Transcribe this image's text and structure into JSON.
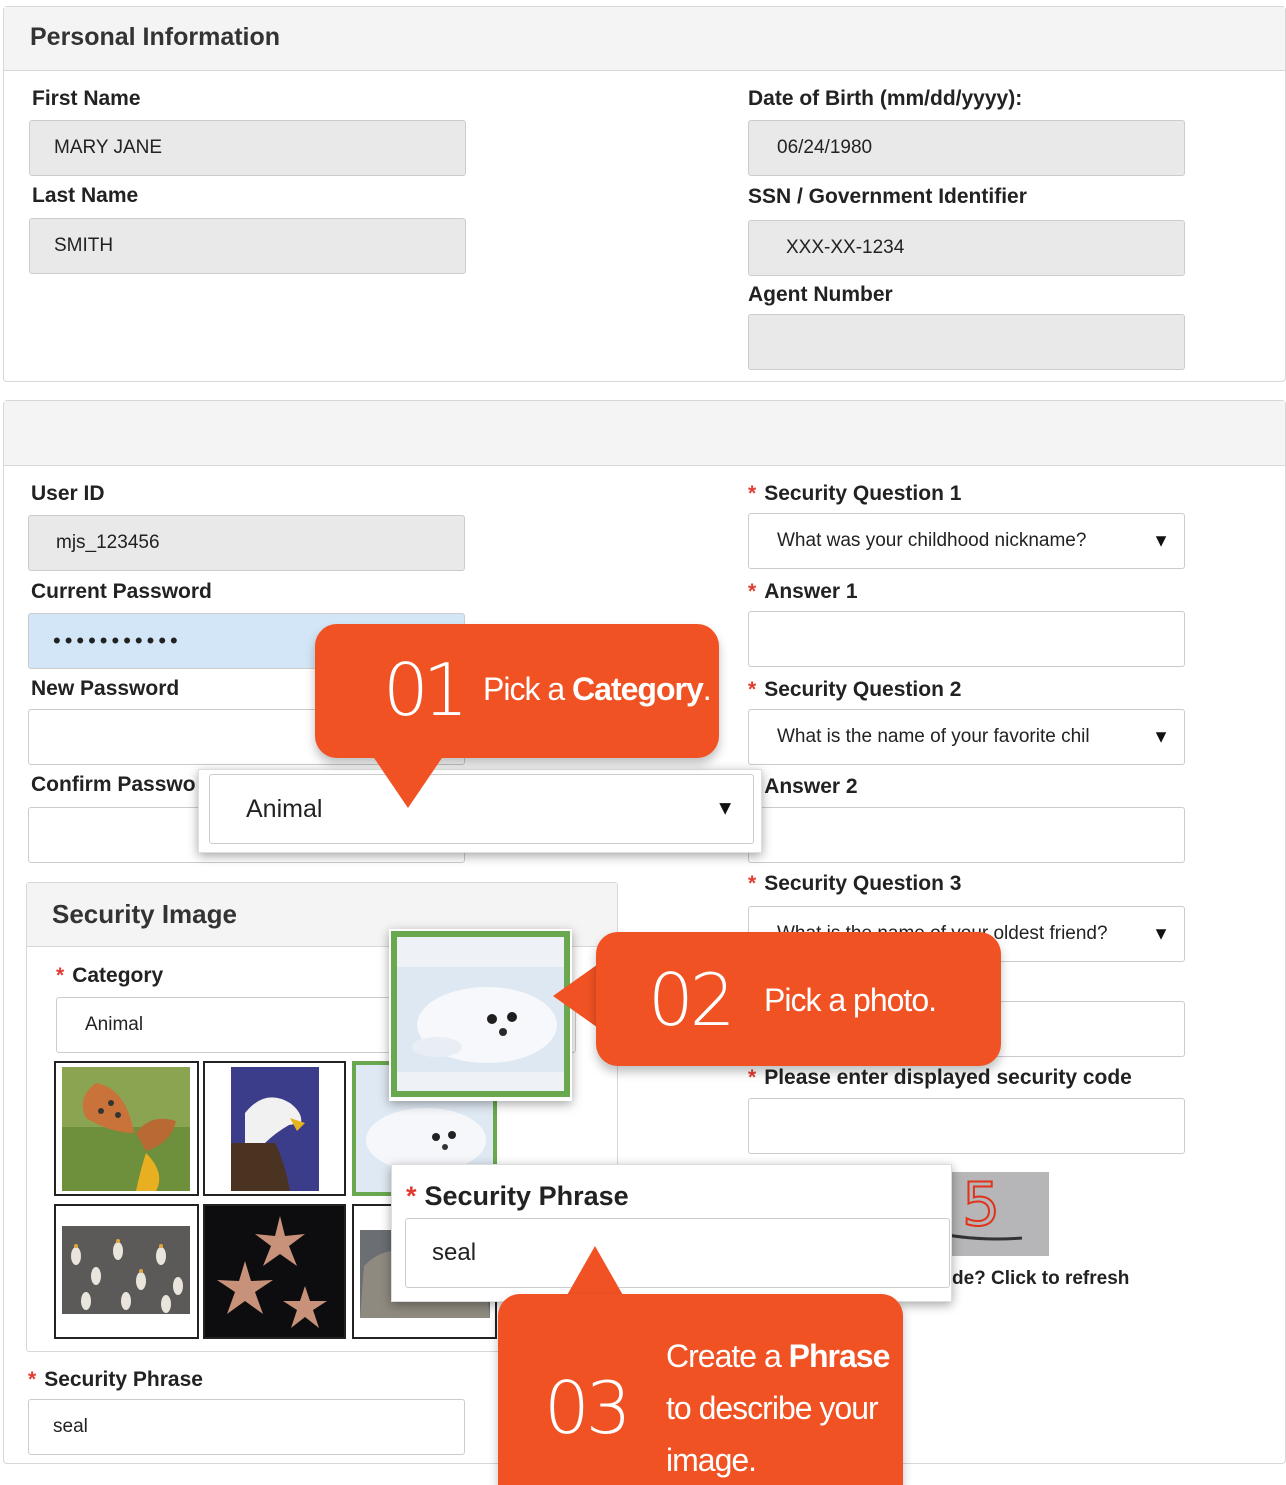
{
  "personal": {
    "title": "Personal Information",
    "first_name_label": "First Name",
    "first_name_value": "MARY JANE",
    "last_name_label": "Last Name",
    "last_name_value": "SMITH",
    "dob_label": "Date of Birth (mm/dd/yyyy):",
    "dob_value": "06/24/1980",
    "ssn_label": "SSN / Government Identifier",
    "ssn_value": "XXX-XX-1234",
    "agent_label": "Agent Number",
    "agent_value": ""
  },
  "account": {
    "user_id_label": "User ID",
    "user_id_value": "mjs_123456",
    "current_password_label": "Current Password",
    "current_password_value": "•••••••••••",
    "new_password_label": "New Password",
    "confirm_password_label": "Confirm Passwo",
    "sq1_label": "Security Question 1",
    "sq1_value": "What was your childhood nickname?",
    "answer1_label": "Answer 1",
    "sq2_label": "Security Question 2",
    "sq2_value": "What is the name of your favorite chil",
    "answer2_label": "Answer 2",
    "sq3_label": "Security Question 3",
    "sq3_value": "What is the name of your oldest friend?",
    "security_code_label": "Please enter displayed security code",
    "captcha_text": "5",
    "refresh_text": "de? Click to refresh",
    "required_mark": "*"
  },
  "security_image": {
    "title": "Security Image",
    "category_label": "Category",
    "category_value": "Animal",
    "phrase_label": "Security Phrase",
    "phrase_value": "seal",
    "images": [
      "butterfly",
      "eagle",
      "seal",
      "penguins",
      "starfish",
      "wolf"
    ]
  },
  "callouts": {
    "c1_num": "01",
    "c1_pre": "Pick a ",
    "c1_bold": "Category",
    "c1_post": ".",
    "c2_num": "02",
    "c2_text": "Pick a photo.",
    "c3_num": "03",
    "c3_pre": "Create a ",
    "c3_bold": "Phrase",
    "c3_line2": "to describe your",
    "c3_line3": "image."
  },
  "popups": {
    "category_value": "Animal",
    "phrase_label": "Security Phrase",
    "phrase_value": "seal"
  },
  "colors": {
    "accent": "#f05223",
    "selected": "#6aa84f",
    "required": "#e03c31"
  },
  "icons": {
    "dropdown": "caret-down-icon"
  }
}
